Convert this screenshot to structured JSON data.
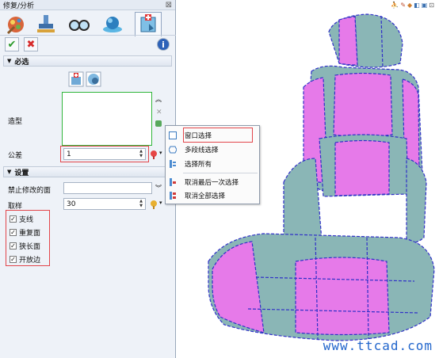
{
  "panel": {
    "title": "修复/分析",
    "close_glyph": "⊠"
  },
  "tabs": [
    {
      "icon": "heal-icon"
    },
    {
      "icon": "stamp-icon"
    },
    {
      "icon": "glasses-icon"
    },
    {
      "icon": "sphere-icon"
    },
    {
      "icon": "analysis-icon"
    }
  ],
  "actions": {
    "ok": "✔",
    "cancel": "✖",
    "info": "i"
  },
  "required": {
    "header": "必选",
    "shape_label": "造型",
    "tolerance_label": "公差",
    "tolerance_value": "1"
  },
  "settings": {
    "header": "设置",
    "forbid_label": "禁止修改的面",
    "forbid_value": "",
    "sample_label": "取样",
    "sample_value": "30",
    "checks": [
      {
        "label": "支线",
        "checked": true
      },
      {
        "label": "重复面",
        "checked": true
      },
      {
        "label": "狭长面",
        "checked": true
      },
      {
        "label": "开放边",
        "checked": true
      }
    ]
  },
  "context_menu": {
    "items": [
      "窗口选择",
      "多段线选择",
      "选择所有",
      "取消最后一次选择",
      "取消全部选择"
    ]
  },
  "viewport": {
    "watermark": "www.ttcad.com"
  },
  "colors": {
    "magenta": "#e67ae9",
    "teal": "#8ab6b6",
    "edge": "#3030c8"
  }
}
